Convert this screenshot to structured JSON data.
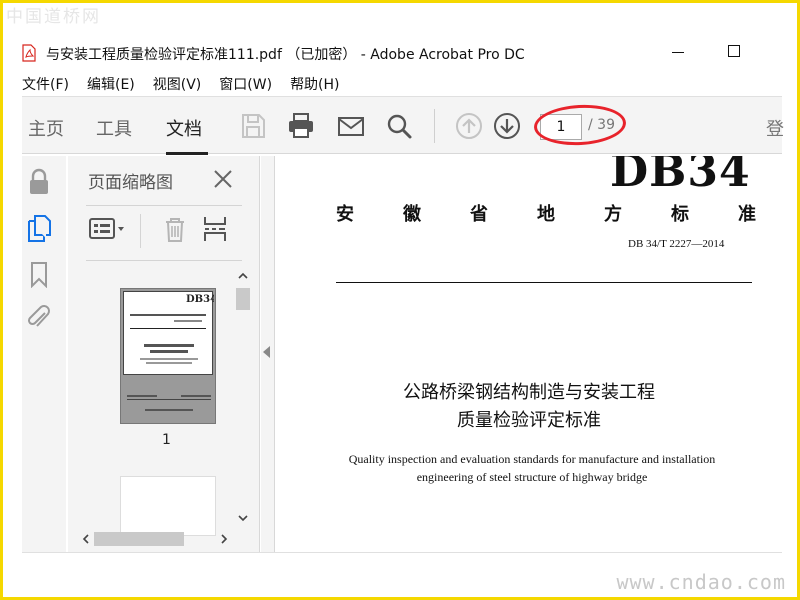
{
  "watermark": {
    "top": "中国道桥网",
    "bottom": "www.cndao.com"
  },
  "window": {
    "title": "与安装工程质量检验评定标准111.pdf （已加密） - Adobe Acrobat Pro DC"
  },
  "menu": {
    "items": [
      "文件(F)",
      "编辑(E)",
      "视图(V)",
      "窗口(W)",
      "帮助(H)"
    ]
  },
  "toolbar": {
    "tabs": [
      {
        "label": "主页"
      },
      {
        "label": "工具"
      },
      {
        "label": "文档"
      }
    ],
    "icons": [
      "save-icon",
      "print-icon",
      "email-icon",
      "search-icon",
      "page-up-icon",
      "page-down-icon"
    ],
    "page_current": "1",
    "page_total": "/ 39",
    "signin_partial": "登"
  },
  "left_rail": {
    "icons": [
      "lock-icon",
      "page-thumbnails-icon",
      "bookmark-icon",
      "attachment-icon"
    ]
  },
  "side_panel": {
    "title": "页面缩略图",
    "thumbnail_page_label": "1"
  },
  "document": {
    "standard_code_large": "DB34",
    "standard_heading_chars": [
      "安",
      "徽",
      "省",
      "地",
      "方",
      "标",
      "准"
    ],
    "standard_number": "DB 34/T  2227—2014",
    "title_cn_line1": "公路桥梁钢结构制造与安装工程",
    "title_cn_line2": "质量检验评定标准",
    "title_en_line1": "Quality inspection and evaluation standards for manufacture and installation",
    "title_en_line2": "engineering of steel structure of highway bridge"
  },
  "colors": {
    "annotation_ellipse": "#e8232b",
    "frame_border": "#f5d800",
    "pdf_icon_red": "#d7261e"
  }
}
